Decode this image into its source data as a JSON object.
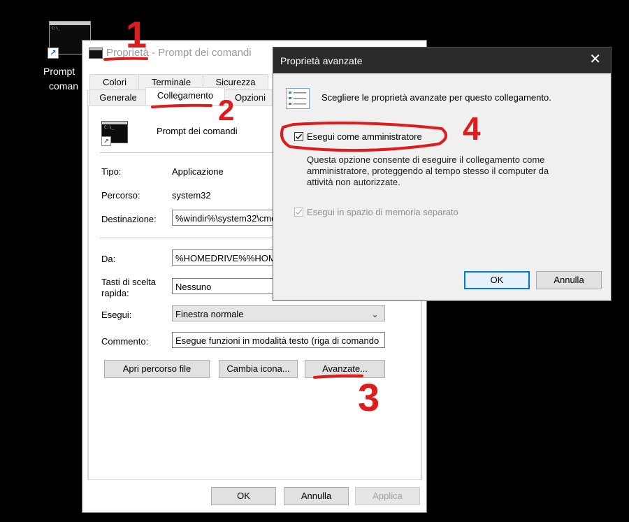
{
  "desktop": {
    "icon_label_line1": "Prompt",
    "icon_label_line2": "coman"
  },
  "props_window": {
    "title": "Proprietà - Prompt dei comandi",
    "tabs_top": [
      "Colori",
      "Terminale",
      "Sicurezza"
    ],
    "tabs_bottom": [
      "Generale",
      "Collegamento",
      "Opzioni"
    ],
    "app_name": "Prompt dei comandi",
    "fields": {
      "tipo_label": "Tipo:",
      "tipo_value": "Applicazione",
      "percorso_label": "Percorso:",
      "percorso_value": "system32",
      "destinazione_label": "Destinazione:",
      "destinazione_value": "%windir%\\system32\\cmd",
      "da_label": "Da:",
      "da_value": "%HOMEDRIVE%%HOM",
      "tasti_label_1": "Tasti di scelta",
      "tasti_label_2": "rapida:",
      "tasti_value": "Nessuno",
      "esegui_label": "Esegui:",
      "esegui_value": "Finestra normale",
      "commento_label": "Commento:",
      "commento_value": "Esegue funzioni in modalità testo (riga di comando"
    },
    "buttons": {
      "apri": "Apri percorso file",
      "cambia": "Cambia icona...",
      "avanzate": "Avanzate...",
      "ok": "OK",
      "annulla": "Annulla",
      "applica": "Applica"
    }
  },
  "advanced_dialog": {
    "title": "Proprietà avanzate",
    "header": "Scegliere le proprietà avanzate per questo collegamento.",
    "run_as_admin_label": "Esegui come amministratore",
    "run_as_admin_checked": true,
    "desc_line1": "Questa opzione consente di eseguire il collegamento come",
    "desc_line2": "amministratore, proteggendo al tempo stesso il computer da",
    "desc_line3": "attività non autorizzate.",
    "separate_memory_label": "Esegui in spazio di memoria separato",
    "separate_memory_checked": true,
    "ok": "OK",
    "cancel": "Annulla"
  },
  "annotations": {
    "step1": "1",
    "step2": "2",
    "step3": "3",
    "step4": "4",
    "color": "#e01b1b"
  }
}
